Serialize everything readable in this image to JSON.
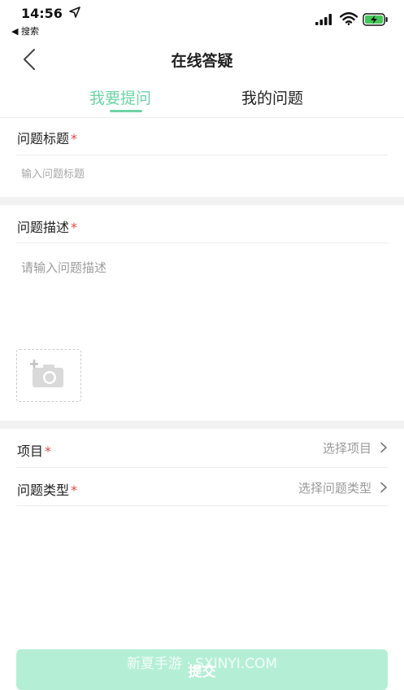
{
  "status_bar": {
    "time": "14:56",
    "back_app": "◀ 搜索",
    "icons": [
      "location-arrow-icon",
      "signal-icon",
      "wifi-icon",
      "battery-charging-icon"
    ]
  },
  "nav": {
    "title": "在线答疑",
    "back_icon": "chevron-left-icon"
  },
  "tabs": [
    {
      "label": "我要提问",
      "active": true
    },
    {
      "label": "我的问题",
      "active": false
    }
  ],
  "form": {
    "title_label": "问题标题",
    "title_placeholder": "输入问题标题",
    "description_label": "问题描述",
    "description_placeholder": "请输入问题描述",
    "required_mark": "*",
    "upload_icon": "add-photo-camera-icon",
    "project_label": "项目",
    "project_value": "选择项目",
    "type_label": "问题类型",
    "type_value": "选择问题类型"
  },
  "submit_label": "提交",
  "watermark": "新夏手游 · SXINYI.COM",
  "colors": {
    "accent": "#6ed3a6",
    "submit_bg": "#b4efd5",
    "required": "#e04848",
    "section_gap": "#f2f2f2"
  }
}
